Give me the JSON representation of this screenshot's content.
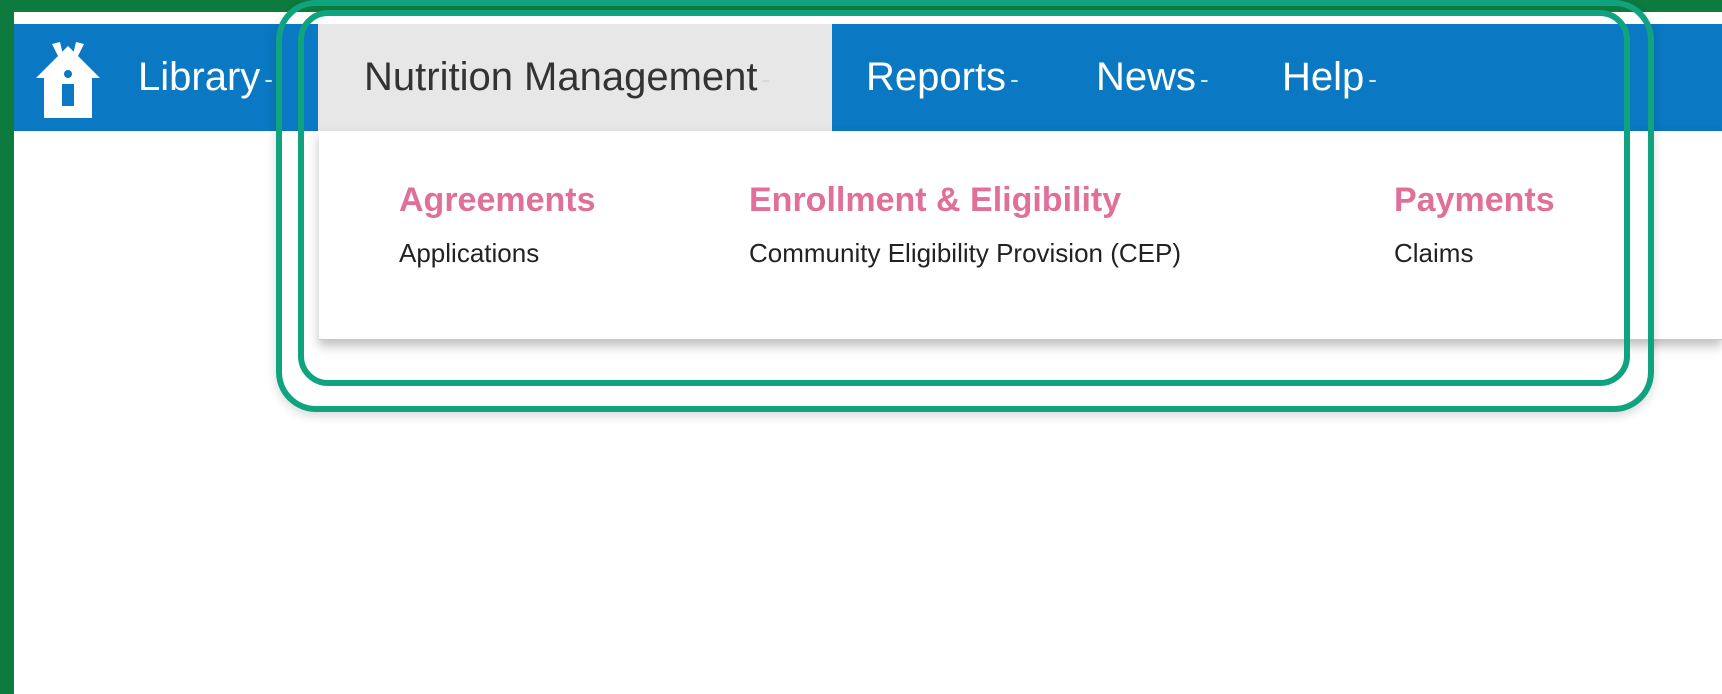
{
  "nav": {
    "items": [
      {
        "label": "Library",
        "caret": "-"
      },
      {
        "label": "Nutrition Management",
        "caret": "-"
      },
      {
        "label": "Reports",
        "caret": "-"
      },
      {
        "label": "News",
        "caret": "-"
      },
      {
        "label": "Help",
        "caret": "-"
      }
    ],
    "active": "Nutrition Management"
  },
  "dropdown": {
    "columns": [
      {
        "heading": "Agreements",
        "links": [
          "Applications"
        ]
      },
      {
        "heading": "Enrollment & Eligibility",
        "links": [
          "Community Eligibility Provision (CEP)"
        ]
      },
      {
        "heading": "Payments",
        "links": [
          "Claims"
        ]
      }
    ]
  },
  "colors": {
    "frame": "#0d7a3e",
    "navbar": "#0a78c2",
    "active_tab": "#e7e7e7",
    "heading_pink": "#e0709a",
    "highlight": "#10a37f"
  },
  "icons": {
    "logo": "house-windmill-logo-icon"
  }
}
